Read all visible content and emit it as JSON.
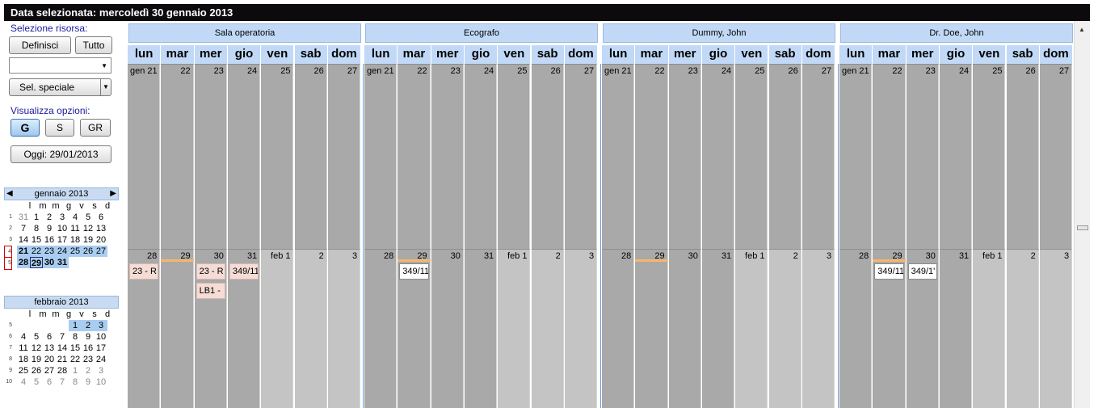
{
  "title": "Data selezionata: mercoledì 30 gennaio 2013",
  "left": {
    "resource_label": "Selezione risorsa:",
    "define_button": "Definisci",
    "all_button": "Tutto",
    "select_value": "",
    "special_button": "Sel. speciale",
    "view_label": "Visualizza opzioni:",
    "view_g": "G",
    "view_s": "S",
    "view_gr": "GR",
    "today_button": "Oggi: 29/01/2013"
  },
  "cal1": {
    "title": "gennaio 2013",
    "weekdays": [
      "l",
      "m",
      "m",
      "g",
      "v",
      "s",
      "d"
    ],
    "weeks": [
      "1",
      "2",
      "3",
      "4",
      "5"
    ],
    "rows": [
      [
        "31",
        "1",
        "2",
        "3",
        "4",
        "5",
        "6"
      ],
      [
        "7",
        "8",
        "9",
        "10",
        "11",
        "12",
        "13"
      ],
      [
        "14",
        "15",
        "16",
        "17",
        "18",
        "19",
        "20"
      ],
      [
        "21",
        "22",
        "23",
        "24",
        "25",
        "26",
        "27"
      ],
      [
        "28",
        "29",
        "30",
        "31",
        "",
        "",
        ""
      ]
    ]
  },
  "cal2": {
    "title": "febbraio 2013",
    "weekdays": [
      "l",
      "m",
      "m",
      "g",
      "v",
      "s",
      "d"
    ],
    "weeks": [
      "5",
      "6",
      "7",
      "8",
      "9",
      "10"
    ],
    "rows": [
      [
        "",
        "",
        "",
        "",
        "1",
        "2",
        "3"
      ],
      [
        "4",
        "5",
        "6",
        "7",
        "8",
        "9",
        "10"
      ],
      [
        "11",
        "12",
        "13",
        "14",
        "15",
        "16",
        "17"
      ],
      [
        "18",
        "19",
        "20",
        "21",
        "22",
        "23",
        "24"
      ],
      [
        "25",
        "26",
        "27",
        "28",
        "1",
        "2",
        "3"
      ],
      [
        "4",
        "5",
        "6",
        "7",
        "8",
        "9",
        "10"
      ]
    ]
  },
  "resources": [
    "Sala operatoria",
    "Ecografo",
    "Dummy, John",
    "Dr. Doe, John"
  ],
  "days": [
    "lun",
    "mar",
    "mer",
    "gio",
    "ven",
    "sab",
    "dom"
  ],
  "week1": [
    "gen 21",
    "22",
    "23",
    "24",
    "25",
    "26",
    "27"
  ],
  "week2": [
    "28",
    "29",
    "30",
    "31",
    "feb 1",
    "2",
    "3"
  ],
  "events": {
    "e1": "23 - R",
    "e2": "23 - R",
    "e3": "LB1 -",
    "e4": "349/11",
    "e5": "349/11",
    "e6": "349/11",
    "e7": "349/1'"
  },
  "colors": {
    "gray_dark": "#a9a9a9",
    "gray_light": "#c4c4c4",
    "today_bar": "#f7b56a",
    "header_blue": "#c1d9f6"
  }
}
